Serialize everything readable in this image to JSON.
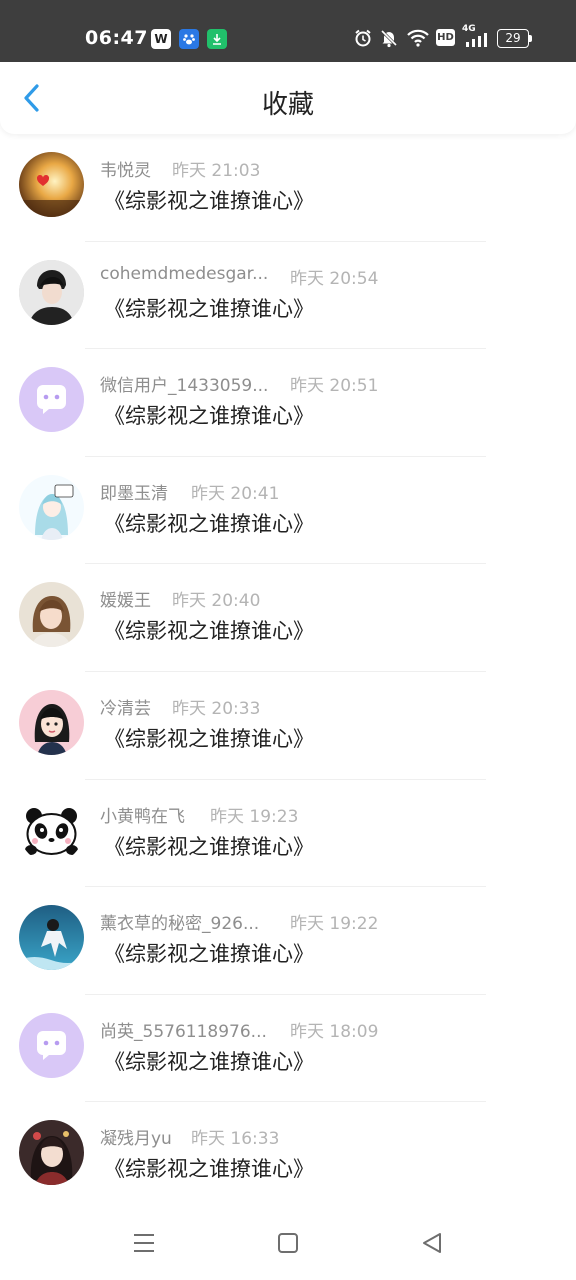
{
  "status_bar": {
    "time": "06:47",
    "battery": "29",
    "network": "4G",
    "hd": "HD",
    "app_icons": [
      "wps-icon",
      "baidu-icon",
      "download-icon"
    ]
  },
  "header": {
    "title": "收藏"
  },
  "items": [
    {
      "name": "韦悦灵",
      "time": "昨天 21:03",
      "title": "《综影视之谁撩谁心》",
      "avatar": "photo-sunset-heart"
    },
    {
      "name": "cohemdmedesgar...",
      "time": "昨天 20:54",
      "title": "《综影视之谁撩谁心》",
      "avatar": "photo-boy"
    },
    {
      "name": "微信用户_1433059...",
      "time": "昨天 20:51",
      "title": "《综影视之谁撩谁心》",
      "avatar": "default-chat-bubble"
    },
    {
      "name": "即墨玉清",
      "time": "昨天 20:41",
      "title": "《综影视之谁撩谁心》",
      "avatar": "anime-girl"
    },
    {
      "name": "媛媛王",
      "time": "昨天 20:40",
      "title": "《综影视之谁撩谁心》",
      "avatar": "photo-girl"
    },
    {
      "name": "冷清芸",
      "time": "昨天 20:33",
      "title": "《综影视之谁撩谁心》",
      "avatar": "cartoon-girl"
    },
    {
      "name": "小黄鸭在飞",
      "time": "昨天 19:23",
      "title": "《综影视之谁撩谁心》",
      "avatar": "panda"
    },
    {
      "name": "薰衣草的秘密_926...",
      "time": "昨天 19:22",
      "title": "《综影视之谁撩谁心》",
      "avatar": "anime-scene"
    },
    {
      "name": "尚英_5576118976...",
      "time": "昨天 18:09",
      "title": "《综影视之谁撩谁心》",
      "avatar": "default-chat-bubble"
    },
    {
      "name": "凝残月yu",
      "time": "昨天 16:33",
      "title": "《综影视之谁撩谁心》",
      "avatar": "anime-dark"
    }
  ],
  "colors": {
    "accent": "#2f9be8",
    "status_bar": "#3e3e3e",
    "name_text": "#8e8e8e",
    "time_text": "#b4b4b4",
    "default_avatar": "#d9c8f7"
  },
  "nav_bar": {
    "icons": [
      "menu-icon",
      "home-icon",
      "back-triangle-icon"
    ]
  }
}
